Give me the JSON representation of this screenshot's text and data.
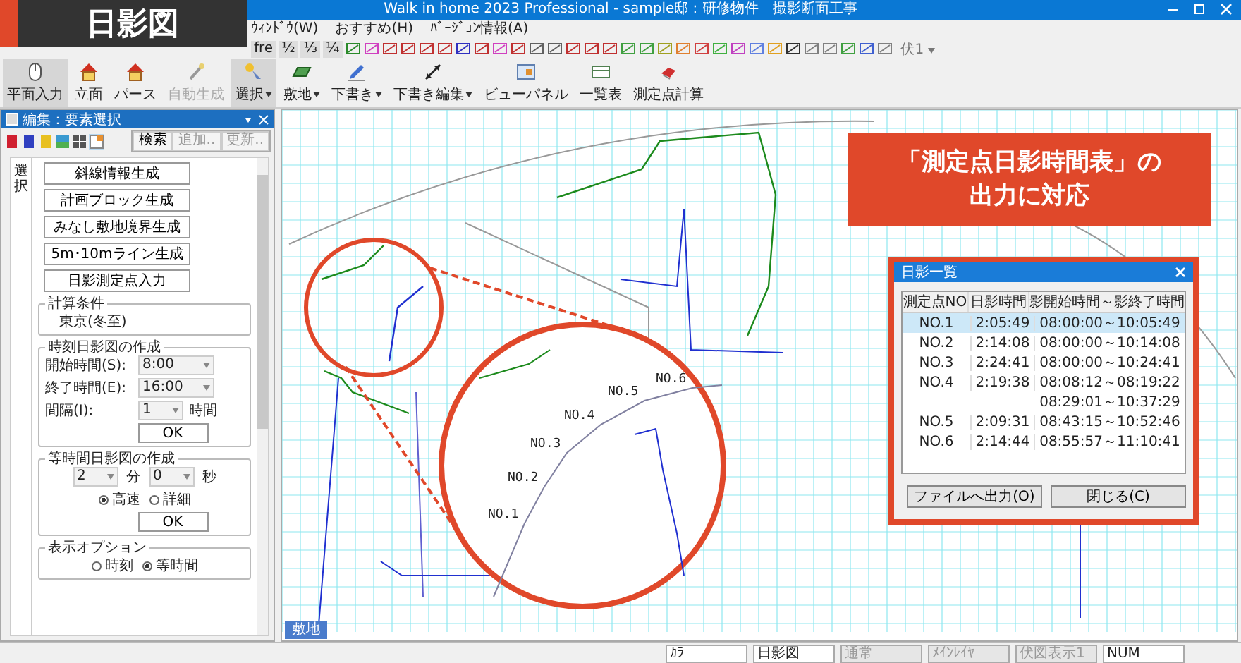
{
  "overlay_label": {
    "text": "日影図"
  },
  "window": {
    "title": "Walk in home 2023 Professional - sample邸 : 研修物件　撮影断面工事"
  },
  "menu": [
    "ｳｨﾝﾄﾞｳ(W)",
    "おすすめ(H)",
    "ﾊﾞｰｼﾞｮﾝ情報(A)"
  ],
  "toolbar_texts": [
    "fre",
    "½",
    "⅓",
    "¼"
  ],
  "toolbar_dropdown": "伏1",
  "ribbon": [
    {
      "label": "平面入力",
      "selected": true,
      "disabled": false,
      "dropdown": false
    },
    {
      "label": "立面",
      "selected": false,
      "disabled": false,
      "dropdown": false
    },
    {
      "label": "パース",
      "selected": false,
      "disabled": false,
      "dropdown": false
    },
    {
      "label": "自動生成",
      "selected": false,
      "disabled": true,
      "dropdown": false
    },
    {
      "label": "選択",
      "selected": true,
      "disabled": false,
      "dropdown": true
    },
    {
      "label": "敷地",
      "selected": false,
      "disabled": false,
      "dropdown": true
    },
    {
      "label": "下書き",
      "selected": false,
      "disabled": false,
      "dropdown": true
    },
    {
      "label": "下書き編集",
      "selected": false,
      "disabled": false,
      "dropdown": true
    },
    {
      "label": "ビューパネル",
      "selected": false,
      "disabled": false,
      "dropdown": false
    },
    {
      "label": "一覧表",
      "selected": false,
      "disabled": false,
      "dropdown": false
    },
    {
      "label": "測定点計算",
      "selected": false,
      "disabled": false,
      "dropdown": false
    }
  ],
  "panel": {
    "title": "編集：要素選択",
    "top_buttons": [
      {
        "label": "検索",
        "disabled": false
      },
      {
        "label": "追加..",
        "disabled": true
      },
      {
        "label": "更新..",
        "disabled": true
      }
    ],
    "tab": "選択",
    "actions": [
      "斜線情報生成",
      "計画ブロック生成",
      "みなし敷地境界生成",
      "5m･10mライン生成",
      "日影測定点入力"
    ],
    "calc_group": {
      "legend": "計算条件",
      "value": "東京(冬至)"
    },
    "time_group": {
      "legend": "時刻日影図の作成",
      "rows": [
        {
          "label": "開始時間(S):",
          "value": "8:00"
        },
        {
          "label": "終了時間(E):",
          "value": "16:00"
        },
        {
          "label": "間隔(I):",
          "value": "1",
          "unit": "時間"
        }
      ],
      "ok": "OK"
    },
    "equal_group": {
      "legend": "等時間日影図の作成",
      "minutes": "2",
      "minutes_unit": "分",
      "seconds": "0",
      "seconds_unit": "秒",
      "modes": [
        {
          "label": "高速",
          "selected": true
        },
        {
          "label": "詳細",
          "selected": false
        }
      ],
      "ok": "OK"
    },
    "display_group": {
      "legend": "表示オプション",
      "options": [
        {
          "label": "時刻",
          "selected": false
        },
        {
          "label": "等時間",
          "selected": true
        }
      ]
    }
  },
  "canvas": {
    "points": [
      "NO.1",
      "NO.2",
      "NO.3",
      "NO.4",
      "NO.5",
      "NO.6"
    ],
    "callout": [
      "「測定点日影時間表」の",
      "出力に対応"
    ],
    "dialog": {
      "title": "日影一覧",
      "columns": [
        "測定点NO",
        "日影時間",
        "影開始時間～影終了時間"
      ],
      "rows": [
        {
          "no": "NO.1",
          "time": "2:05:49",
          "range": "08:00:00～10:05:49",
          "selected": true
        },
        {
          "no": "NO.2",
          "time": "2:14:08",
          "range": "08:00:00～10:14:08",
          "selected": false
        },
        {
          "no": "NO.3",
          "time": "2:24:41",
          "range": "08:00:00～10:24:41",
          "selected": false
        },
        {
          "no": "NO.4",
          "time": "2:19:38",
          "range": "08:08:12～08:19:22",
          "selected": false
        },
        {
          "range": "08:29:01～10:37:29",
          "selected": false
        },
        {
          "no": "NO.5",
          "time": "2:09:31",
          "range": "08:43:15～10:52:46",
          "selected": false
        },
        {
          "no": "NO.6",
          "time": "2:14:44",
          "range": "08:55:57～11:10:41",
          "selected": false
        }
      ],
      "buttons": [
        "ファイルへ出力(O)",
        "閉じる(C)"
      ]
    },
    "sheet_tab": "敷地"
  },
  "status_bar": [
    {
      "text": "ｶﾗｰ",
      "disabled": false
    },
    {
      "text": "日影図",
      "disabled": false
    },
    {
      "text": "通常",
      "disabled": true
    },
    {
      "text": "ﾒｲﾝﾚｲﾔ",
      "disabled": true
    },
    {
      "text": "伏図表示1",
      "disabled": true
    },
    {
      "text": "NUM",
      "disabled": false
    }
  ]
}
